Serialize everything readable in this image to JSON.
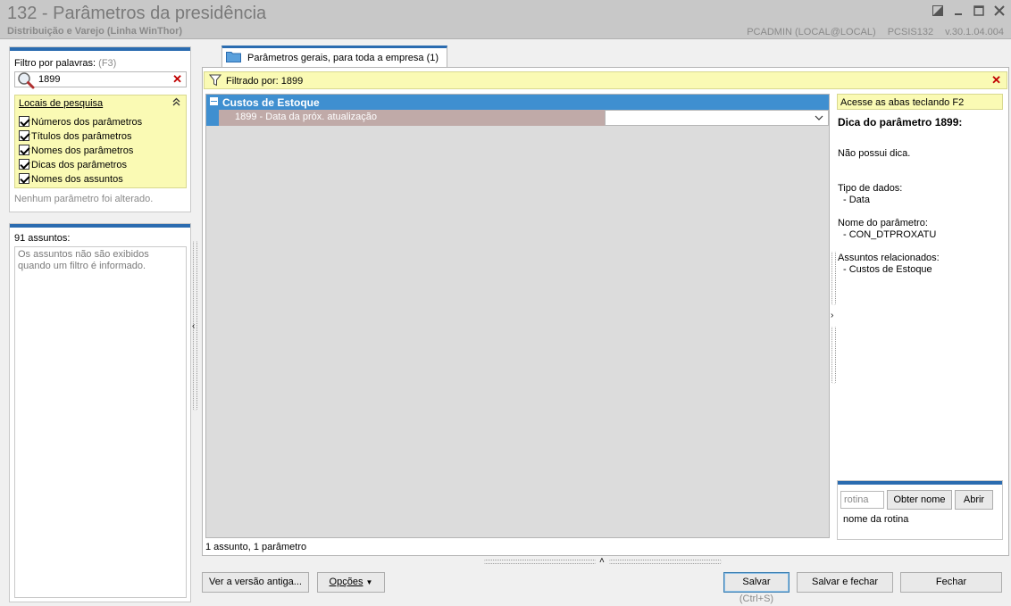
{
  "window": {
    "title": "132 - Parâmetros da presidência",
    "subtitle": "Distribuição e Varejo (Linha WinThor)",
    "user": "PCADMIN (LOCAL@LOCAL)",
    "program": "PCSIS132",
    "version": "v.30.1.04.004"
  },
  "filter_panel": {
    "label": "Filtro por palavras:",
    "shortcut": "(F3)",
    "search_value": "1899",
    "locais_title": "Locais de pesquisa",
    "options": [
      {
        "label": "Números dos parâmetros",
        "checked": true
      },
      {
        "label": "Títulos dos parâmetros",
        "checked": true
      },
      {
        "label": "Nomes dos parâmetros",
        "checked": true
      },
      {
        "label": "Dicas dos parâmetros",
        "checked": true
      },
      {
        "label": "Nomes dos assuntos",
        "checked": true
      }
    ],
    "status": "Nenhum parâmetro foi alterado."
  },
  "subjects_panel": {
    "count_label": "91 assuntos:",
    "message": "Os assuntos não são exibidos quando um filtro é informado."
  },
  "tab": {
    "label": "Parâmetros gerais, para toda a empresa",
    "count": "(1)"
  },
  "filter_bar": {
    "label": "Filtrado por: 1899"
  },
  "grid": {
    "group": "Custos de Estoque",
    "row": {
      "name": "1899 - Data da próx. atualização",
      "value": ""
    },
    "status": "1 assunto, 1 parâmetro"
  },
  "help": {
    "tip": "Acesse as abas teclando F2",
    "title": "Dica do parâmetro 1899:",
    "no_tip": "Não possui dica.",
    "data_type_label": "Tipo de dados:",
    "data_type_value": "- Data",
    "param_name_label": "Nome do parâmetro:",
    "param_name_value": "- CON_DTPROXATU",
    "related_label": "Assuntos relacionados:",
    "related_value": "- Custos de Estoque"
  },
  "rotina": {
    "placeholder": "rotina",
    "get_name": "Obter nome",
    "open": "Abrir",
    "caption": "nome da rotina"
  },
  "buttons": {
    "old_version": "Ver a versão antiga...",
    "options": "Opções",
    "save": "Salvar",
    "save_shortcut": "(Ctrl+S)",
    "save_close": "Salvar e fechar",
    "close": "Fechar"
  },
  "colors": {
    "accent_blue": "#2b6cb0",
    "group_blue": "#3f8fd0",
    "highlight_yellow": "#fafab4",
    "clear_red": "#c00000"
  }
}
